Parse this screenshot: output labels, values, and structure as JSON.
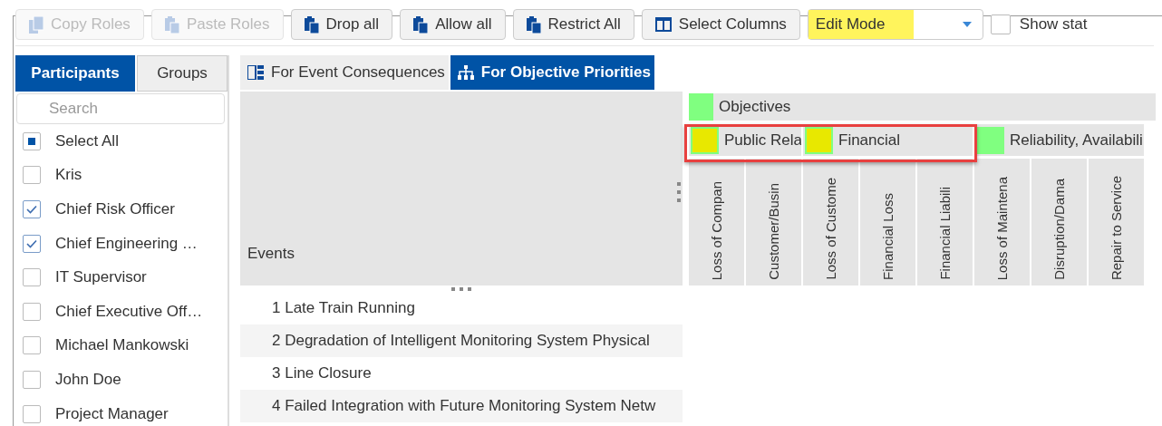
{
  "toolbar": {
    "buttons": [
      {
        "label": "Copy Roles",
        "disabled": true
      },
      {
        "label": "Paste Roles",
        "disabled": true
      },
      {
        "label": "Drop all",
        "disabled": false
      },
      {
        "label": "Allow all",
        "disabled": false
      },
      {
        "label": "Restrict All",
        "disabled": false
      },
      {
        "label": "Select Columns",
        "disabled": false
      }
    ],
    "mode_select": {
      "value": "Edit Mode",
      "highlighted": true
    },
    "show_checkbox": {
      "label": "Show stat",
      "checked": false
    }
  },
  "sidebar": {
    "tabs": [
      {
        "label": "Participants",
        "selected": true
      },
      {
        "label": "Groups",
        "selected": false
      }
    ],
    "search": {
      "placeholder": "Search"
    },
    "select_all": {
      "label": "Select All",
      "partial": true
    },
    "items": [
      {
        "label": "Kris",
        "checked": false
      },
      {
        "label": "Chief Risk Officer",
        "checked": true
      },
      {
        "label": "Chief Engineering …",
        "checked": true
      },
      {
        "label": "IT Supervisor",
        "checked": false
      },
      {
        "label": "Chief Executive Off…",
        "checked": false
      },
      {
        "label": "Michael Mankowski",
        "checked": false
      },
      {
        "label": "John Doe",
        "checked": false
      },
      {
        "label": "Project Manager",
        "checked": false
      }
    ]
  },
  "main": {
    "tabs": [
      {
        "label": "For Event Consequences",
        "selected": false
      },
      {
        "label": "For Objective Priorities",
        "selected": true
      }
    ],
    "events_header": "Events",
    "events": [
      "1 Late Train Running",
      "2 Degradation of Intelligent Monitoring System Physical",
      "3 Line Closure",
      "4 Failed Integration with Future Monitoring System Netw"
    ],
    "objectives": {
      "label": "Objectives",
      "color": "#80ff80",
      "groups": [
        {
          "label": "Public Rela",
          "color": "#e8e800",
          "highlighted": true
        },
        {
          "label": "Financial",
          "color": "#e8e800",
          "highlighted": true
        },
        {
          "label": "Reliability, Availabili",
          "color": "#80ff80",
          "highlighted": false
        }
      ],
      "columns": [
        "Loss of Compan",
        "Customer/Busin",
        "Loss of Custome",
        "Financial Loss",
        "Financial Liabili",
        "Loss of Maintena",
        "Disruption/Dama",
        "Repair to Service"
      ]
    }
  }
}
